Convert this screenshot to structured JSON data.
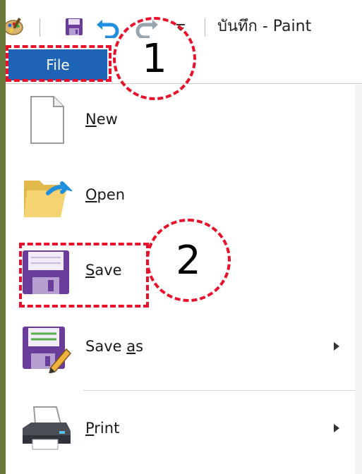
{
  "window": {
    "title": "บันทึก - Paint"
  },
  "quick_access": {
    "icons": [
      "paint-app-icon",
      "save-icon",
      "undo-icon",
      "redo-icon",
      "customize-dropdown-icon"
    ]
  },
  "ribbon": {
    "file_tab_label": "File"
  },
  "file_menu": {
    "items": [
      {
        "prefix": "",
        "underline": "N",
        "suffix": "ew",
        "icon": "new-document-icon",
        "has_submenu": false
      },
      {
        "prefix": "",
        "underline": "O",
        "suffix": "pen",
        "icon": "open-folder-icon",
        "has_submenu": false
      },
      {
        "prefix": "",
        "underline": "S",
        "suffix": "ave",
        "icon": "floppy-disk-icon",
        "has_submenu": false
      },
      {
        "prefix": "Save ",
        "underline": "a",
        "suffix": "s",
        "icon": "save-as-icon",
        "has_submenu": true
      },
      {
        "prefix": "",
        "underline": "P",
        "suffix": "rint",
        "icon": "printer-icon",
        "has_submenu": true
      }
    ]
  },
  "annotations": {
    "step_1": "1",
    "step_2": "2",
    "color": "#e8102a"
  },
  "colors": {
    "file_tab": "#1e63b6",
    "background": "#6b7a3b"
  }
}
